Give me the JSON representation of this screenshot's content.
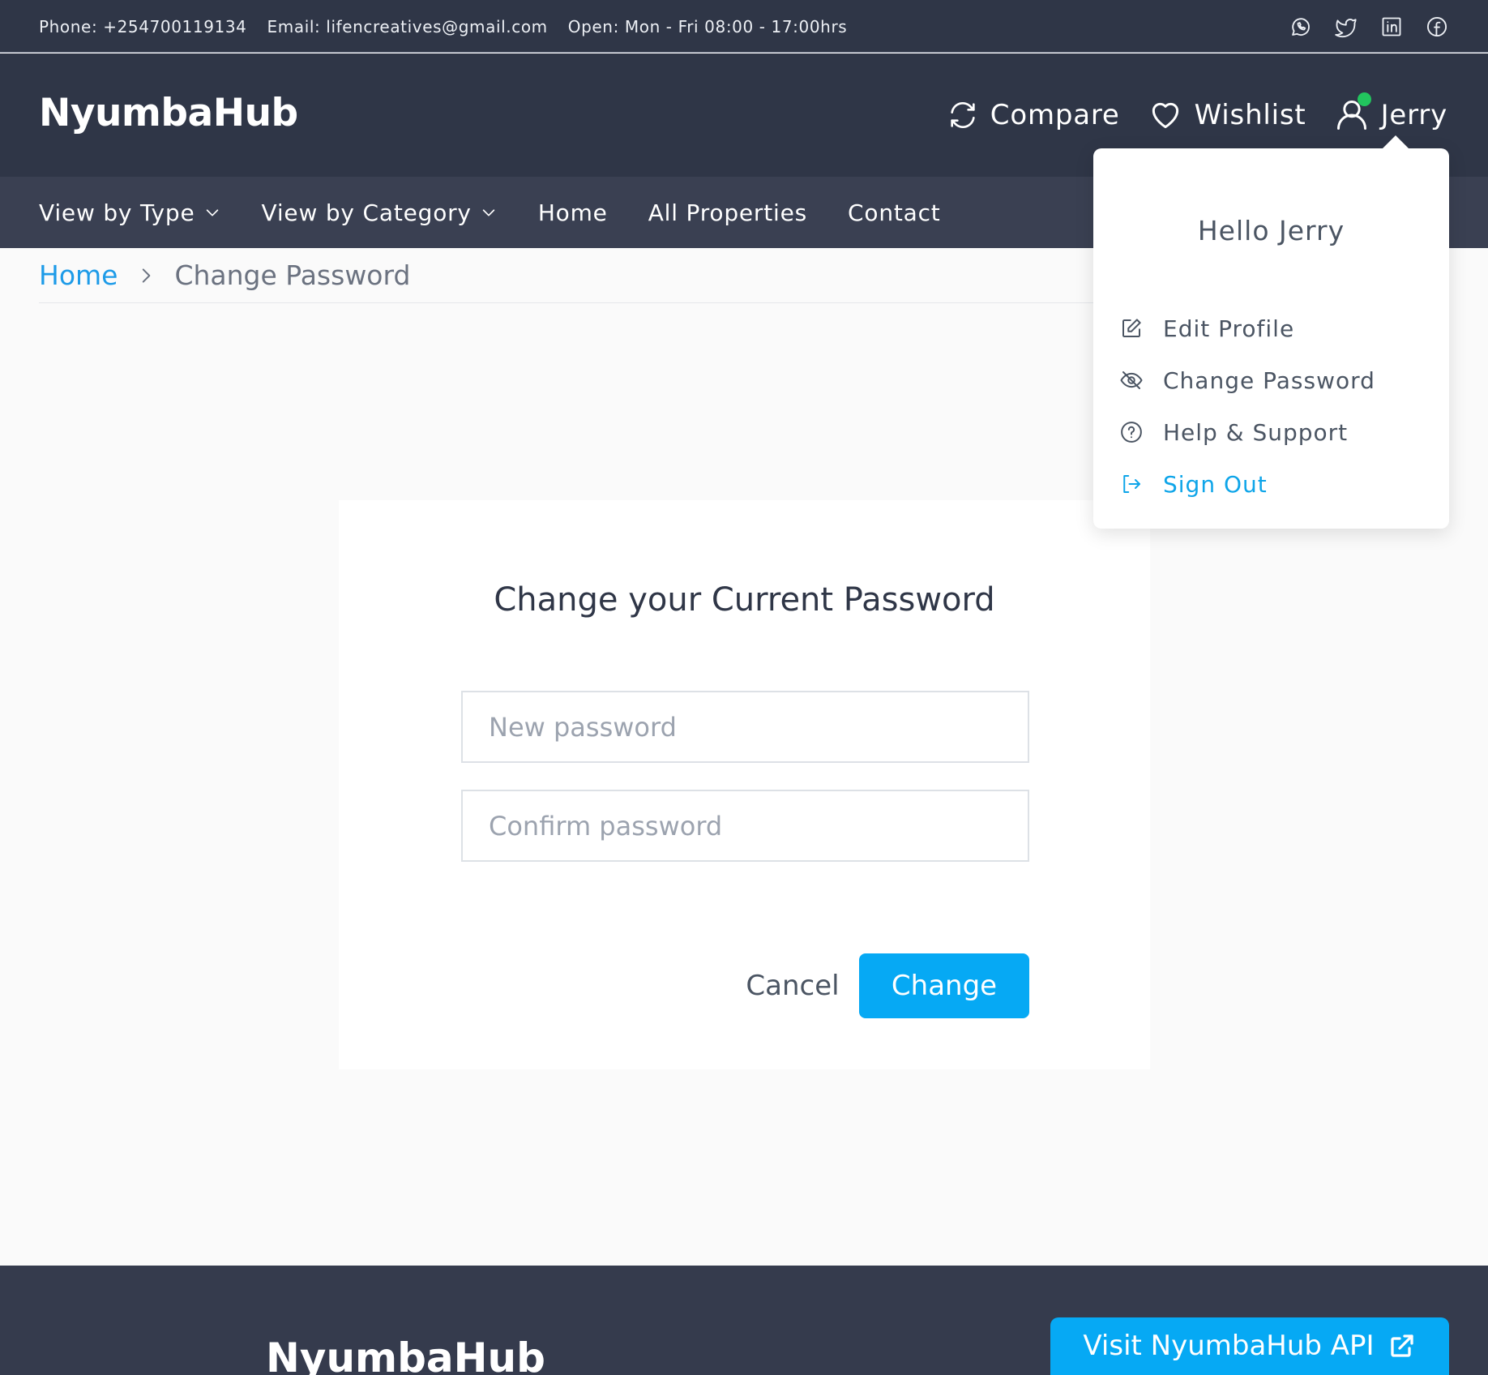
{
  "topbar": {
    "phone": "Phone: +254700119134",
    "email": "Email: lifencreatives@gmail.com",
    "hours": "Open: Mon - Fri 08:00 - 17:00hrs",
    "social_icons": [
      "whatsapp-icon",
      "twitter-icon",
      "linkedin-icon",
      "facebook-icon"
    ]
  },
  "header": {
    "logo": "NyumbaHub",
    "compare_label": "Compare",
    "wishlist_label": "Wishlist",
    "user_name": "Jerry"
  },
  "nav": {
    "items": [
      {
        "label": "View by Type"
      },
      {
        "label": "View by Category"
      },
      {
        "label": "Home"
      },
      {
        "label": "All Properties"
      },
      {
        "label": "Contact"
      }
    ]
  },
  "breadcrumb": {
    "home": "Home",
    "current": "Change Password"
  },
  "form": {
    "title": "Change your Current Password",
    "new_password_placeholder": "New password",
    "confirm_password_placeholder": "Confirm password",
    "cancel_label": "Cancel",
    "change_label": "Change"
  },
  "dropdown": {
    "greeting": "Hello Jerry",
    "items": [
      {
        "label": "Edit Profile",
        "icon": "edit-icon"
      },
      {
        "label": "Change Password",
        "icon": "eye-off-icon"
      },
      {
        "label": "Help & Support",
        "icon": "help-icon"
      },
      {
        "label": "Sign Out",
        "icon": "sign-out-icon"
      }
    ]
  },
  "footer": {
    "logo": "NyumbaHub",
    "api_button": "Visit NyumbaHub API"
  },
  "colors": {
    "dark_bg": "#2f3647",
    "nav_bg": "#3a4052",
    "accent": "#06a9f4",
    "online": "#22c55e"
  }
}
